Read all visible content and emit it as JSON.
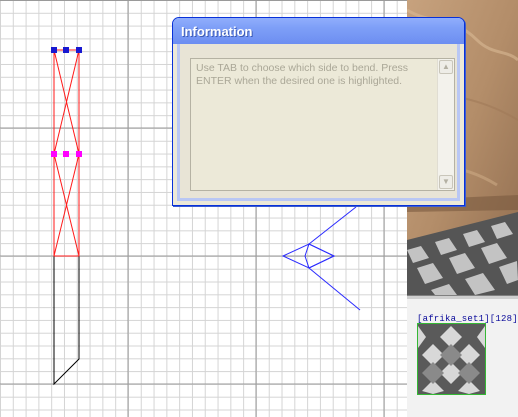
{
  "dialog": {
    "title": "Information",
    "message": "Use TAB to choose which side to bend. Press ENTER when the desired one is highlighted.",
    "scroll_up_icon": "triangle-up",
    "scroll_down_icon": "triangle-down"
  },
  "texture_browser": {
    "texture_name": "[afrika_set1][128]"
  },
  "colors": {
    "grid_minor": "#d4d4d4",
    "grid_major": "#9a9a9a",
    "brush_selected": "#ff0000",
    "vertex_handle": "#ff00ff",
    "edge_handle": "#1818d0",
    "entity": "#2b2bff",
    "dialog_title_blue": "#7d9ef7",
    "texture_highlight": "#35b835"
  }
}
